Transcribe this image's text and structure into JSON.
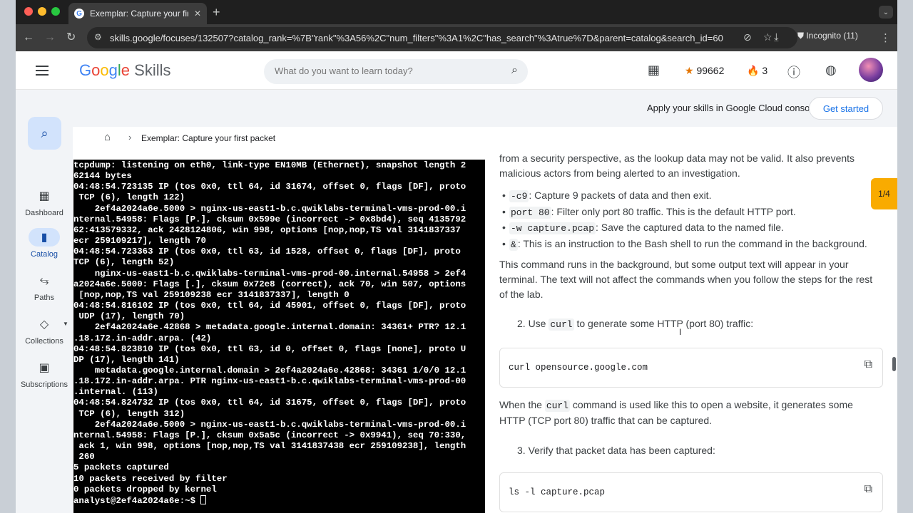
{
  "browser": {
    "tab_title": "Exemplar: Capture your first packet",
    "url": "skills.google/focuses/132507?catalog_rank=%7B\"rank\"%3A56%2C\"num_filters\"%3A1%2C\"has_search\"%3Atrue%7D&parent=catalog&search_id=608...",
    "incognito_label": "Incognito (11)"
  },
  "header": {
    "brand_google": "Google",
    "brand_skills": "Skills",
    "search_placeholder": "What do you want to learn today?",
    "points": "99662",
    "streak": "3"
  },
  "banner": {
    "text": "Apply your skills in Google Cloud console",
    "button": "Get started"
  },
  "sidebar": {
    "items": [
      {
        "label": "Dashboard"
      },
      {
        "label": "Catalog"
      },
      {
        "label": "Paths"
      },
      {
        "label": "Collections"
      },
      {
        "label": "Subscriptions"
      }
    ]
  },
  "breadcrumb": {
    "current": "Exemplar: Capture your first packet"
  },
  "terminal": {
    "lines": [
      "tcpdump: listening on eth0, link-type EN10MB (Ethernet), snapshot length 2",
      "62144 bytes",
      "04:48:54.723135 IP (tos 0x0, ttl 64, id 31674, offset 0, flags [DF], proto",
      " TCP (6), length 122)",
      "    2ef4a2024a6e.5000 > nginx-us-east1-b.c.qwiklabs-terminal-vms-prod-00.i",
      "nternal.54958: Flags [P.], cksum 0x599e (incorrect -> 0x8bd4), seq 4135792",
      "62:413579332, ack 2428124806, win 998, options [nop,nop,TS val 3141837337",
      "ecr 259109217], length 70",
      "04:48:54.723363 IP (tos 0x0, ttl 63, id 1528, offset 0, flags [DF], proto",
      "TCP (6), length 52)",
      "    nginx-us-east1-b.c.qwiklabs-terminal-vms-prod-00.internal.54958 > 2ef4",
      "a2024a6e.5000: Flags [.], cksum 0x72e8 (correct), ack 70, win 507, options",
      " [nop,nop,TS val 259109238 ecr 3141837337], length 0",
      "04:48:54.816102 IP (tos 0x0, ttl 64, id 45901, offset 0, flags [DF], proto",
      " UDP (17), length 70)",
      "    2ef4a2024a6e.42868 > metadata.google.internal.domain: 34361+ PTR? 12.1",
      ".18.172.in-addr.arpa. (42)",
      "04:48:54.823810 IP (tos 0x0, ttl 63, id 0, offset 0, flags [none], proto U",
      "DP (17), length 141)",
      "    metadata.google.internal.domain > 2ef4a2024a6e.42868: 34361 1/0/0 12.1",
      ".18.172.in-addr.arpa. PTR nginx-us-east1-b.c.qwiklabs-terminal-vms-prod-00",
      ".internal. (113)",
      "04:48:54.824732 IP (tos 0x0, ttl 64, id 31675, offset 0, flags [DF], proto",
      " TCP (6), length 312)",
      "    2ef4a2024a6e.5000 > nginx-us-east1-b.c.qwiklabs-terminal-vms-prod-00.i",
      "nternal.54958: Flags [P.], cksum 0x5a5c (incorrect -> 0x9941), seq 70:330,",
      " ack 1, win 998, options [nop,nop,TS val 3141837438 ecr 259109238], length",
      " 260",
      "5 packets captured",
      "10 packets received by filter",
      "0 packets dropped by kernel"
    ],
    "prompt": "analyst@2ef4a2024a6e:~$ "
  },
  "instructions": {
    "intro_line1": "from a security perspective, as the lookup data may not be valid. It also prevents",
    "intro_line2": "malicious actors from being alerted to an investigation.",
    "bullets": [
      {
        "code": "-c9",
        "text": ": Capture 9 packets of data and then exit."
      },
      {
        "code": "port 80",
        "text": ": Filter only port 80 traffic. This is the default HTTP port."
      },
      {
        "code": "-w capture.pcap",
        "text": ": Save the captured data to the named file."
      },
      {
        "code": "&",
        "text": ": This is an instruction to the Bash shell to run the command in the background."
      }
    ],
    "para1": "This command runs in the background, but some output text will appear in your terminal. The text will not affect the commands when you follow the steps for the rest of the lab.",
    "step2_pre": "2. Use ",
    "step2_code": "curl",
    "step2_post": " to generate some HTTP (port 80) traffic:",
    "code1": "curl opensource.google.com",
    "para2_pre": "When the ",
    "para2_code": "curl",
    "para2_post": " command is used like this to open a website, it generates some HTTP (TCP port 80) traffic that can be captured.",
    "step3": "3. Verify that packet data has been captured:",
    "code2": "ls -l capture.pcap",
    "pager": "1/4"
  }
}
